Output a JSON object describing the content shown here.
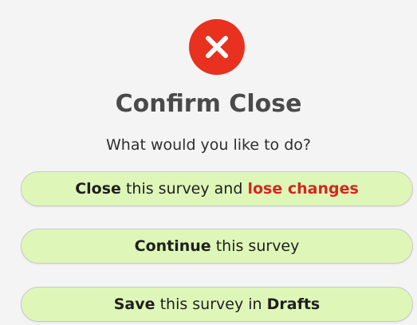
{
  "dialog": {
    "icon": "close-x-icon",
    "accent_color": "#e8311f",
    "title": "Confirm Close",
    "subtitle": "What would you like to do?"
  },
  "buttons": {
    "discard": {
      "bold": "Close",
      "middle": " this survey and ",
      "danger": "lose changes",
      "background": "#def7b8"
    },
    "continue": {
      "bold": "Continue",
      "rest": " this survey"
    },
    "save": {
      "bold_1": "Save",
      "middle": " this survey in ",
      "bold_2": "Drafts"
    }
  }
}
